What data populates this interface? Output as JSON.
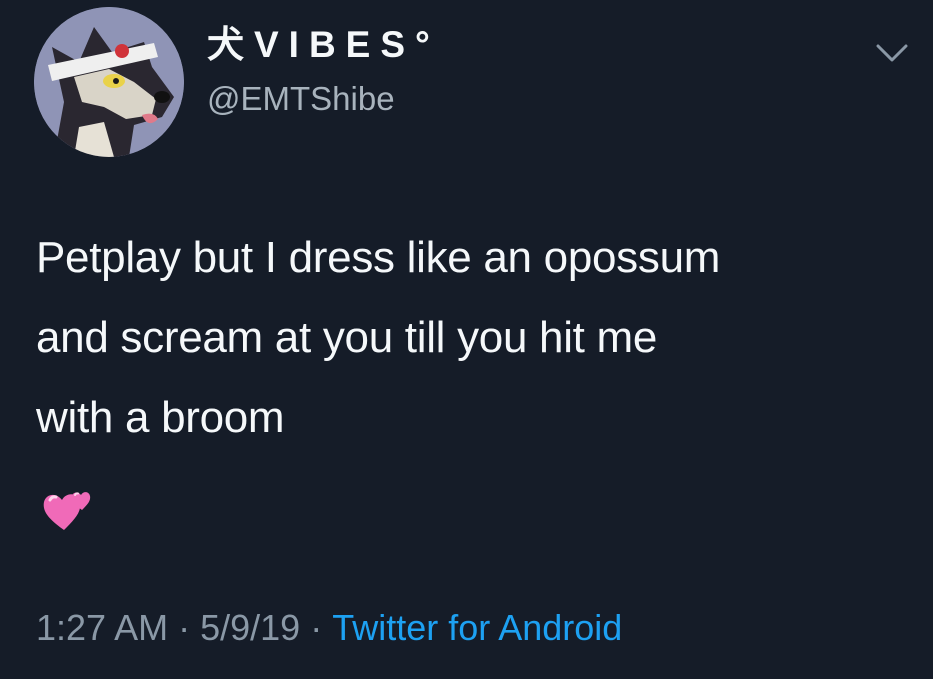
{
  "tweet": {
    "display_name": "犬VIBES°",
    "handle": "@EMTShibe",
    "text": "Petplay but I dress like an opossum\nand scream at you till you hit me\nwith a broom",
    "emoji": "two-hearts",
    "time": "1:27 AM",
    "date": "5/9/19",
    "separator": "·",
    "source": "Twitter for Android"
  },
  "icons": {
    "more": "chevron-down-icon",
    "avatar": "wolf-avatar"
  },
  "colors": {
    "background": "#151c28",
    "primary_text": "#f5f8fa",
    "secondary_text": "#8a98a6",
    "link": "#1da1f2",
    "emoji_pink": "#f06ab8"
  }
}
